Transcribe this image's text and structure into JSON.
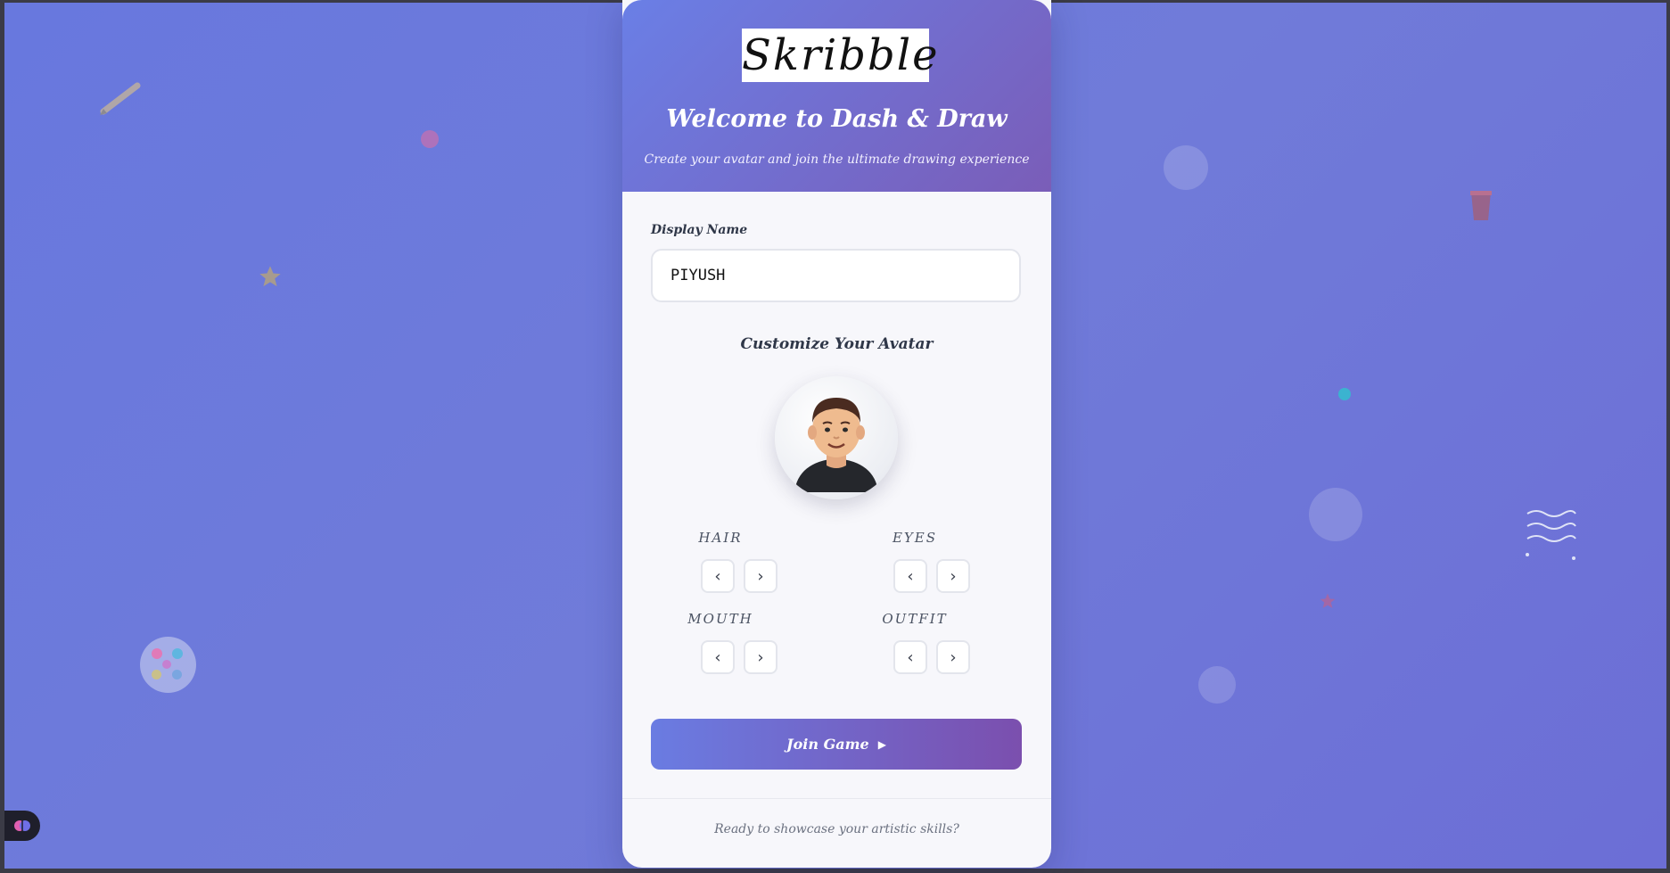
{
  "logo": {
    "text": "Skribble"
  },
  "header": {
    "title": "Welcome to Dash & Draw",
    "subtitle": "Create your avatar and join the ultimate drawing experience"
  },
  "form": {
    "display_name_label": "Display Name",
    "display_name_value": "PIYUSH",
    "customize_title": "Customize Your Avatar"
  },
  "avatar_options": [
    {
      "label": "HAIR"
    },
    {
      "label": "EYES"
    },
    {
      "label": "MOUTH"
    },
    {
      "label": "OUTFIT"
    }
  ],
  "join_button": {
    "label": "Join Game"
  },
  "footer": {
    "text": "Ready to showcase your artistic skills?"
  },
  "colors": {
    "header_gradient_start": "#6a7fe6",
    "header_gradient_end": "#7a5db8",
    "background": "#6c77db"
  }
}
